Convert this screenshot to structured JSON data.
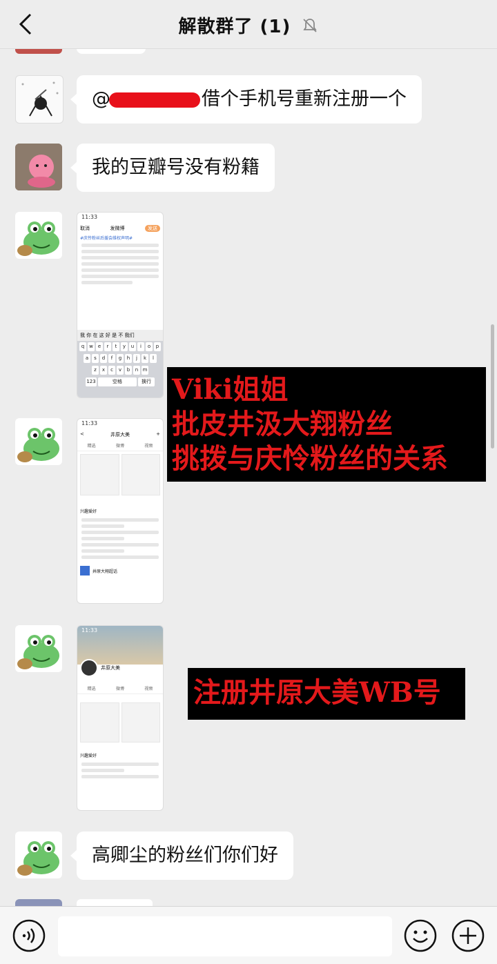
{
  "header": {
    "title": "解散群了 (1)",
    "mute_icon": "bell-muted-icon",
    "back_icon": "chevron-left-icon"
  },
  "messages": [
    {
      "type": "text",
      "sender": "user-bw",
      "text_prefix": "@",
      "text": "借个手机号重新注册一个"
    },
    {
      "type": "text",
      "sender": "user-pink",
      "text": "我的豆瓣号没有粉籍"
    },
    {
      "type": "image",
      "sender": "user-frog",
      "desc_text": "#庆怜粉丝后援会维权声明#"
    },
    {
      "type": "image",
      "sender": "user-frog",
      "profile_name": "井原大美"
    },
    {
      "type": "image",
      "sender": "user-frog",
      "profile_name": "井原大美"
    },
    {
      "type": "text",
      "sender": "user-frog",
      "text": "高卿尘的粉丝们你们好"
    }
  ],
  "overlays": {
    "annotation1": [
      "Viki姐姐",
      "批皮井汲大翔粉丝",
      "挑拨与庆怜粉丝的关系"
    ],
    "annotation2": [
      "注册井原大美WB号"
    ]
  },
  "shot1": {
    "cancel": "取消",
    "title": "发微博",
    "send": "发送",
    "keys_row1": [
      "q",
      "w",
      "e",
      "r",
      "t",
      "y",
      "u",
      "i",
      "o",
      "p"
    ],
    "keys_row2": [
      "a",
      "s",
      "d",
      "f",
      "g",
      "h",
      "j",
      "k",
      "l"
    ],
    "keys_row3": [
      "z",
      "x",
      "c",
      "v",
      "b",
      "n",
      "m"
    ],
    "candidates": "我 你 在 这 好 是 不 我们",
    "space": "空格",
    "return": "换行",
    "num": "123"
  },
  "shot2": {
    "back": "<",
    "name": "井原大美",
    "tabs": [
      "精选",
      "微博",
      "视频"
    ],
    "section": "兴趣爱好",
    "group": "井原大翔超话"
  },
  "shot3": {
    "name": "井原大美",
    "tabs": [
      "精选",
      "微博",
      "视频"
    ],
    "section": "兴趣爱好"
  },
  "colors": {
    "background": "#ededed",
    "bubble": "#ffffff",
    "overlay_text": "#e3191b",
    "redaction": "#e8101a"
  },
  "footer": {
    "voice_icon": "voice-icon",
    "emoji_icon": "emoji-icon",
    "plus_icon": "plus-circle-icon"
  }
}
